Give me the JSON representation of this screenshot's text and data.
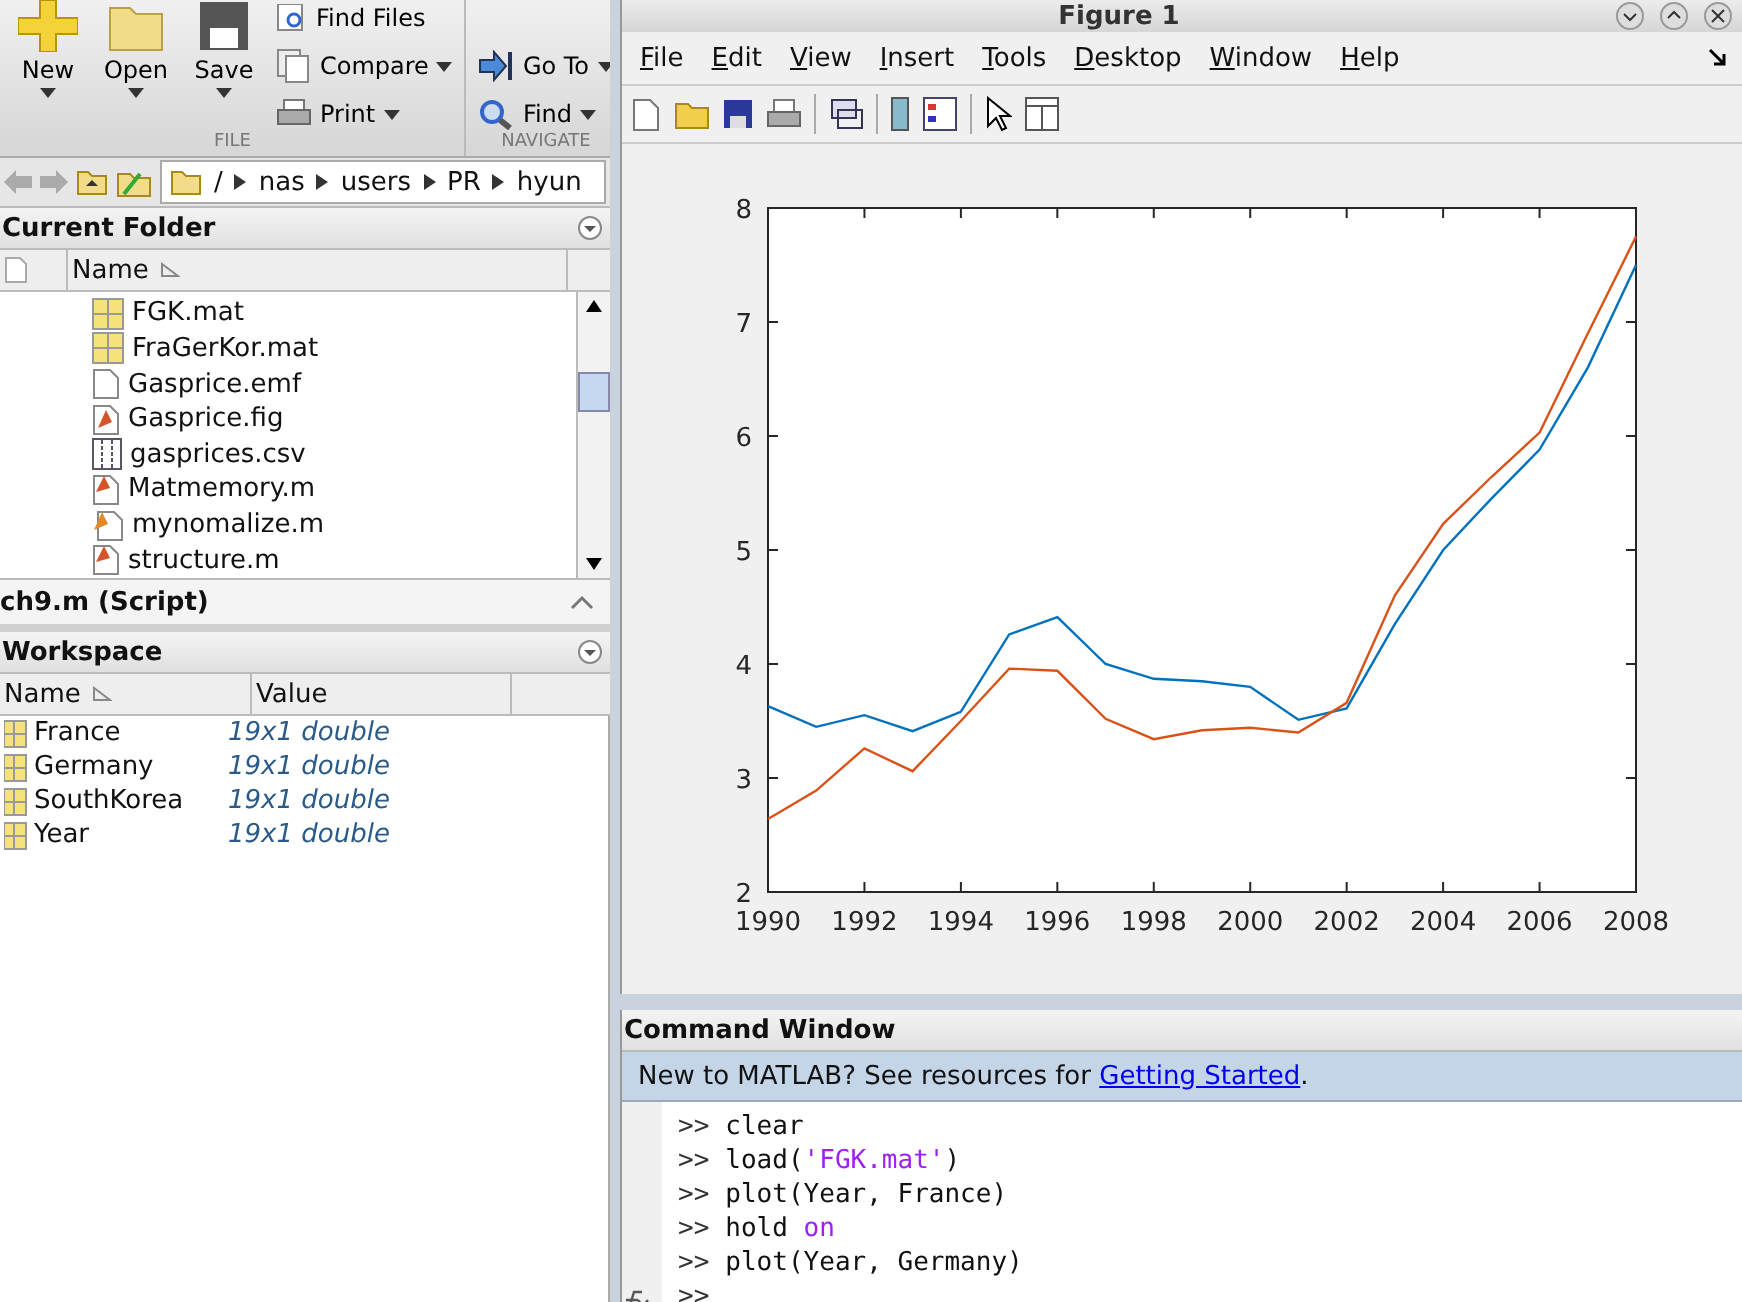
{
  "ribbon": {
    "file_buttons": [
      {
        "label": "New",
        "kind": "new"
      },
      {
        "label": "Open",
        "kind": "open"
      },
      {
        "label": "Save",
        "kind": "save"
      }
    ],
    "file_small": [
      {
        "label": "Find Files",
        "kind": "find-files"
      },
      {
        "label": "Compare",
        "kind": "compare"
      },
      {
        "label": "Print",
        "kind": "print"
      }
    ],
    "file_section": "FILE",
    "navigate_buttons": [
      {
        "label": "Go To",
        "kind": "goto"
      },
      {
        "label": "Find",
        "kind": "find"
      }
    ],
    "navigate_section": "NAVIGATE"
  },
  "address_bar": {
    "path": [
      "/",
      "nas",
      "users",
      "PR",
      "hyun"
    ]
  },
  "current_folder": {
    "title": "Current Folder",
    "column": "Name",
    "files": [
      {
        "name": "FGK.mat",
        "kind": "mat"
      },
      {
        "name": "FraGerKor.mat",
        "kind": "mat"
      },
      {
        "name": "Gasprice.emf",
        "kind": "blank"
      },
      {
        "name": "Gasprice.fig",
        "kind": "fig"
      },
      {
        "name": "gasprices.csv",
        "kind": "csv"
      },
      {
        "name": "Matmemory.m",
        "kind": "script"
      },
      {
        "name": "mynomalize.m",
        "kind": "function"
      },
      {
        "name": "structure.m",
        "kind": "script"
      }
    ]
  },
  "script_bar": {
    "title": "ch9.m  (Script)"
  },
  "workspace": {
    "title": "Workspace",
    "columns": [
      "Name",
      "Value"
    ],
    "rows": [
      {
        "name": "France",
        "value": "19x1 double"
      },
      {
        "name": "Germany",
        "value": "19x1 double"
      },
      {
        "name": "SouthKorea",
        "value": "19x1 double"
      },
      {
        "name": "Year",
        "value": "19x1 double"
      }
    ]
  },
  "figure": {
    "title": "Figure 1",
    "menu": [
      "File",
      "Edit",
      "View",
      "Insert",
      "Tools",
      "Desktop",
      "Window",
      "Help"
    ],
    "chart_data": {
      "type": "line",
      "x": [
        1990,
        1991,
        1992,
        1993,
        1994,
        1995,
        1996,
        1997,
        1998,
        1999,
        2000,
        2001,
        2002,
        2003,
        2004,
        2005,
        2006,
        2007,
        2008
      ],
      "xlim": [
        1990,
        2008
      ],
      "ylim": [
        2,
        8
      ],
      "xticks": [
        1990,
        1992,
        1994,
        1996,
        1998,
        2000,
        2002,
        2004,
        2006,
        2008
      ],
      "yticks": [
        2,
        3,
        4,
        5,
        6,
        7,
        8
      ],
      "series": [
        {
          "color": "#0072bd",
          "values": [
            3.63,
            3.45,
            3.55,
            3.41,
            3.58,
            4.26,
            4.41,
            4.0,
            3.87,
            3.85,
            3.8,
            3.51,
            3.61,
            4.35,
            5.0,
            5.45,
            5.88,
            6.6,
            7.5
          ]
        },
        {
          "color": "#d95319",
          "values": [
            2.64,
            2.89,
            3.26,
            3.06,
            3.5,
            3.96,
            3.94,
            3.52,
            3.34,
            3.42,
            3.44,
            3.4,
            3.66,
            4.6,
            5.23,
            5.64,
            6.03,
            6.9,
            7.75
          ]
        }
      ]
    }
  },
  "command_window": {
    "title": "Command Window",
    "notice": "New to MATLAB? See resources for ",
    "link": "Getting Started",
    "notice_end": ".",
    "lines": [
      {
        "prompt": ">>",
        "parts": [
          {
            "text": "clear",
            "kind": "plain"
          }
        ]
      },
      {
        "prompt": ">>",
        "parts": [
          {
            "text": "load(",
            "kind": "plain"
          },
          {
            "text": "'FGK.mat'",
            "kind": "string"
          },
          {
            "text": ")",
            "kind": "plain"
          }
        ]
      },
      {
        "prompt": ">>",
        "parts": [
          {
            "text": "plot(Year, France)",
            "kind": "plain"
          }
        ]
      },
      {
        "prompt": ">>",
        "parts": [
          {
            "text": "hold ",
            "kind": "plain"
          },
          {
            "text": "on",
            "kind": "keyword"
          }
        ]
      },
      {
        "prompt": ">>",
        "parts": [
          {
            "text": "plot(Year, Germany)",
            "kind": "plain"
          }
        ]
      },
      {
        "prompt": ">>"
      }
    ]
  }
}
